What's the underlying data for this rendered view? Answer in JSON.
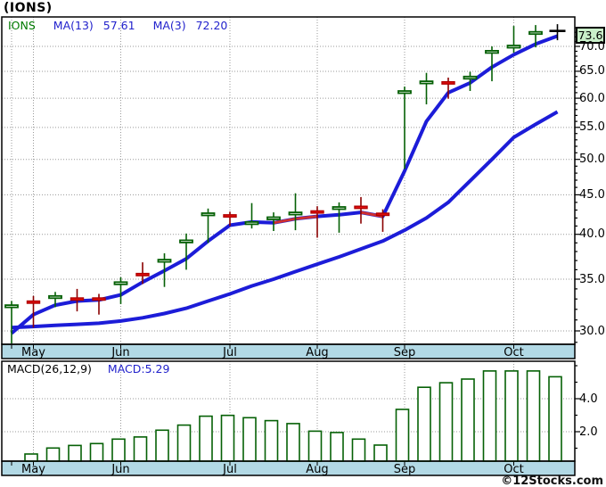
{
  "header": {
    "title": "(IONS)"
  },
  "legend": {
    "symbol": "IONS",
    "ma13_label": "MA(13)",
    "ma13_value": "57.61",
    "ma3_label": "MA(3)",
    "ma3_value": "72.20"
  },
  "price_panel": {
    "last_price_label": "73.6",
    "y_axis_labels": [
      "70.0",
      "65.0",
      "60.0",
      "55.0",
      "50.0",
      "45.0",
      "40.0",
      "35.0",
      "30.0"
    ],
    "months": [
      {
        "label": "May",
        "index": 1
      },
      {
        "label": "Jun",
        "index": 5
      },
      {
        "label": "Jul",
        "index": 10
      },
      {
        "label": "Aug",
        "index": 14
      },
      {
        "label": "Sep",
        "index": 18
      },
      {
        "label": "Oct",
        "index": 23
      }
    ]
  },
  "macd_panel": {
    "header_label": "MACD(26,12,9)",
    "header_value": "MACD:5.29",
    "y_axis_labels": [
      "4.0",
      "2.0"
    ]
  },
  "footer": {
    "copyright": "©12Stocks.com"
  },
  "colors": {
    "up_border": "#056005",
    "up_fill": "#ffffff",
    "up_wick": "#056005",
    "down_fill": "#e81010",
    "down_border": "#b00000",
    "down_wick": "#8b0000",
    "ma_blue": "#1c1cd8",
    "ma_red": "#d03030",
    "strip_blue": "#b2d9e5",
    "grid_gray": "#9a9a9a",
    "flag_bg": "#c9efc9",
    "bar_border": "#056005",
    "bar_fill": "#ffffff",
    "marker_black": "#000000"
  },
  "chart_data": [
    {
      "type": "candlestick",
      "title": "IONS weekly price with MA(3) and MA(13)",
      "x_categories_months": [
        "May",
        "Jun",
        "Jul",
        "Aug",
        "Sep",
        "Oct"
      ],
      "scale": "log",
      "ylim": [
        28.9,
        76.3
      ],
      "y_ticks": [
        70,
        65,
        60,
        55,
        50,
        45,
        40,
        35,
        30
      ],
      "candles": [
        {
          "o": 29.2,
          "h": 32.8,
          "l": 28.9,
          "c": 32.4,
          "d": "up"
        },
        {
          "o": 32.8,
          "h": 33.3,
          "l": 30.3,
          "c": 31.6,
          "d": "down"
        },
        {
          "o": 32.5,
          "h": 33.7,
          "l": 32.2,
          "c": 33.3,
          "d": "up"
        },
        {
          "o": 33.1,
          "h": 34.0,
          "l": 31.8,
          "c": 32.2,
          "d": "down"
        },
        {
          "o": 33.1,
          "h": 33.5,
          "l": 31.5,
          "c": 32.8,
          "d": "down"
        },
        {
          "o": 33.3,
          "h": 35.2,
          "l": 32.5,
          "c": 34.7,
          "d": "up"
        },
        {
          "o": 35.6,
          "h": 36.8,
          "l": 34.5,
          "c": 34.9,
          "d": "down"
        },
        {
          "o": 35.2,
          "h": 37.8,
          "l": 34.2,
          "c": 37.1,
          "d": "up"
        },
        {
          "o": 36.5,
          "h": 40.1,
          "l": 36.0,
          "c": 39.3,
          "d": "up"
        },
        {
          "o": 39.3,
          "h": 43.2,
          "l": 39.0,
          "c": 42.6,
          "d": "up"
        },
        {
          "o": 42.4,
          "h": 42.8,
          "l": 41.0,
          "c": 41.3,
          "d": "down"
        },
        {
          "o": 41.0,
          "h": 43.9,
          "l": 40.7,
          "c": 41.5,
          "d": "up"
        },
        {
          "o": 41.5,
          "h": 42.7,
          "l": 40.4,
          "c": 42.1,
          "d": "up"
        },
        {
          "o": 42.1,
          "h": 45.2,
          "l": 40.5,
          "c": 42.7,
          "d": "up"
        },
        {
          "o": 42.9,
          "h": 43.5,
          "l": 39.6,
          "c": 41.0,
          "d": "down"
        },
        {
          "o": 41.2,
          "h": 44.0,
          "l": 40.2,
          "c": 43.4,
          "d": "up"
        },
        {
          "o": 43.5,
          "h": 44.7,
          "l": 41.3,
          "c": 42.3,
          "d": "down"
        },
        {
          "o": 42.6,
          "h": 43.1,
          "l": 40.3,
          "c": 42.2,
          "d": "down"
        },
        {
          "o": 48.9,
          "h": 62.1,
          "l": 48.6,
          "c": 61.3,
          "d": "up"
        },
        {
          "o": 61.0,
          "h": 64.7,
          "l": 58.9,
          "c": 63.1,
          "d": "up"
        },
        {
          "o": 63.0,
          "h": 63.8,
          "l": 59.9,
          "c": 60.7,
          "d": "down"
        },
        {
          "o": 63.0,
          "h": 64.9,
          "l": 61.3,
          "c": 64.0,
          "d": "up"
        },
        {
          "o": 63.4,
          "h": 70.0,
          "l": 63.1,
          "c": 69.1,
          "d": "up"
        },
        {
          "o": 69.2,
          "h": 74.4,
          "l": 68.7,
          "c": 70.2,
          "d": "up"
        },
        {
          "o": 70.0,
          "h": 74.6,
          "l": 69.8,
          "c": 73.1,
          "d": "up"
        }
      ],
      "last_marker": {
        "price": 73.3,
        "high": 74.8,
        "low": 71.3,
        "label": "73.6"
      },
      "series": [
        {
          "name": "MA(3)",
          "last": 72.2,
          "values": [
            29.8,
            31.5,
            32.4,
            32.8,
            32.9,
            33.4,
            34.7,
            35.9,
            37.2,
            39.2,
            41.1,
            41.5,
            41.4,
            41.9,
            42.2,
            42.4,
            42.7,
            42.2,
            48.3,
            56.0,
            61.0,
            62.8,
            65.8,
            68.3,
            70.5,
            72.2
          ],
          "red_ranges": [
            [
              12,
              14
            ],
            [
              16,
              17
            ]
          ]
        },
        {
          "name": "MA(13)",
          "last": 57.61,
          "values": [
            30.3,
            30.4,
            30.5,
            30.6,
            30.7,
            30.9,
            31.2,
            31.6,
            32.1,
            32.8,
            33.5,
            34.3,
            35.0,
            35.8,
            36.6,
            37.4,
            38.3,
            39.2,
            40.5,
            42.0,
            44.0,
            46.9,
            50.0,
            53.4,
            55.5,
            57.6
          ]
        }
      ]
    },
    {
      "type": "bar",
      "title": "MACD(26,12,9)",
      "last_value": 5.29,
      "ylim": [
        0,
        6.1
      ],
      "y_ticks": [
        2.0,
        4.0
      ],
      "values": [
        0.65,
        1.01,
        1.17,
        1.28,
        1.55,
        1.68,
        2.09,
        2.4,
        2.94,
        2.99,
        2.85,
        2.67,
        2.49,
        2.03,
        1.95,
        1.55,
        1.19,
        3.35,
        4.69,
        4.97,
        5.19,
        5.68,
        5.68,
        5.68,
        5.33
      ]
    }
  ]
}
